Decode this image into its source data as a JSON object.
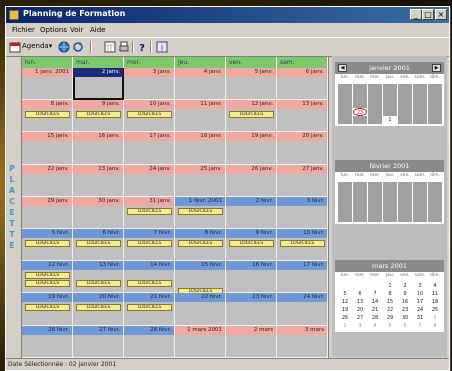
{
  "window": {
    "title": "Planning de Formation"
  },
  "title_buttons": [
    "_",
    "□",
    "×"
  ],
  "menu": [
    "Fichier",
    "Options",
    "Voir",
    "Aide"
  ],
  "toolbar": {
    "agenda_label": "Agenda▾"
  },
  "sidebar_label": [
    "P",
    "L",
    "A",
    "C",
    "E",
    "T",
    "T",
    "E"
  ],
  "week_headers": [
    "lun.",
    "mar.",
    "mer.",
    "jeu.",
    "ven.",
    "sam."
  ],
  "weeks": [
    {
      "color": "red",
      "days": [
        "1 janv. 2001",
        "2 janv.",
        "3 janv.",
        "4 janv.",
        "5 janv.",
        "6 janv."
      ],
      "events": []
    },
    {
      "color": "red",
      "days": [
        "8 janv.",
        "9 janv.",
        "10 janv.",
        "11 janv.",
        "12 janv.",
        "13 janv."
      ],
      "events": [
        [
          0,
          0,
          "LOGICIELS"
        ],
        [
          1,
          0,
          "LOGICIELS"
        ],
        [
          2,
          0,
          "LOGICIELS"
        ],
        [
          4,
          0,
          "LOGICIELS"
        ]
      ]
    },
    {
      "color": "red",
      "days": [
        "15 janv.",
        "16 janv.",
        "17 janv.",
        "18 janv.",
        "19 janv.",
        "20 janv."
      ],
      "events": []
    },
    {
      "color": "red",
      "days": [
        "22 janv.",
        "23 janv.",
        "24 janv.",
        "25 janv.",
        "26 janv.",
        "27 janv."
      ],
      "events": []
    },
    {
      "color": "mix",
      "days": [
        "29 janv.",
        "30 janv.",
        "31 janv.",
        "1 févr. 2001",
        "2 févr.",
        "3 févr."
      ],
      "events": [
        [
          2,
          0,
          "LOGICIELS"
        ],
        [
          3,
          0,
          "LOGICIELS"
        ]
      ]
    },
    {
      "color": "blue",
      "days": [
        "5 févr.",
        "6 févr.",
        "7 févr.",
        "8 févr.",
        "9 févr.",
        "10 févr."
      ],
      "events": [
        [
          0,
          0,
          "LOGICIELS"
        ],
        [
          1,
          0,
          "LOGICIELS"
        ],
        [
          2,
          0,
          "LOGICIELS"
        ],
        [
          3,
          0,
          "LOGICIELS"
        ],
        [
          4,
          0,
          "LOGICIELS"
        ],
        [
          5,
          0,
          "LOGICIELS"
        ]
      ]
    },
    {
      "color": "blue",
      "days": [
        "12 févr.",
        "13 févr.",
        "14 févr.",
        "15 févr.",
        "16 févr.",
        "17 févr."
      ],
      "events": [
        [
          0,
          0,
          "LOGICIELS"
        ],
        [
          0,
          1,
          "LOGICIELS"
        ],
        [
          1,
          1,
          "LOGICIELS"
        ],
        [
          2,
          1,
          "LOGICIELS"
        ],
        [
          3,
          2,
          "LOGICIELS"
        ]
      ]
    },
    {
      "color": "blue",
      "days": [
        "19 févr.",
        "20 févr.",
        "21 févr.",
        "22 févr.",
        "23 févr.",
        "24 févr."
      ],
      "events": [
        [
          0,
          0,
          "LOGICIELS"
        ],
        [
          1,
          0,
          "LOGICIELS"
        ],
        [
          2,
          0,
          "LOGICIELS"
        ]
      ]
    },
    {
      "color": "mix2",
      "days": [
        "26 févr.",
        "27 févr.",
        "28 févr.",
        "1 mars 2001",
        "2 mars",
        "3 mars"
      ],
      "events": []
    }
  ],
  "calendars": [
    {
      "title": "janvier 2001",
      "dows": [
        "lun.",
        "mar.",
        "mer.",
        "jeu.",
        "ven.",
        "sam.",
        "dim."
      ],
      "rows": [
        [
          "1",
          "2",
          "3",
          "4",
          "5",
          "6",
          "7"
        ],
        [
          "8",
          "9",
          "10",
          "11",
          "12",
          "13",
          "14"
        ],
        [
          "15",
          "16",
          "17",
          "18",
          "19",
          "20",
          "21"
        ],
        [
          "22",
          "23",
          "24",
          "25",
          "26",
          "27",
          "28"
        ],
        [
          "29",
          "30",
          "31",
          "1",
          "2",
          "3",
          "4"
        ]
      ]
    },
    {
      "title": "février 2001",
      "dows": [
        "lun.",
        "mar.",
        "mer.",
        "jeu.",
        "ven.",
        "sam.",
        "dim."
      ],
      "rows": [
        [
          "29",
          "30",
          "31",
          "1",
          "2",
          "3",
          "4"
        ],
        [
          "5",
          "6",
          "7",
          "8",
          "9",
          "10",
          "11"
        ],
        [
          "12",
          "13",
          "14",
          "15",
          "16",
          "17",
          "18"
        ],
        [
          "19",
          "20",
          "21",
          "22",
          "23",
          "24",
          "25"
        ],
        [
          "26",
          "27",
          "28",
          "1",
          "2",
          "3",
          "4"
        ]
      ]
    },
    {
      "title": "mars 2001",
      "dows": [
        "lun.",
        "mar.",
        "mer.",
        "jeu.",
        "ven.",
        "sam.",
        "dim."
      ],
      "rows": [
        [
          "",
          "",
          "",
          "1",
          "2",
          "3",
          "4"
        ],
        [
          "5",
          "6",
          "7",
          "8",
          "9",
          "10",
          "11"
        ],
        [
          "12",
          "13",
          "14",
          "15",
          "16",
          "17",
          "18"
        ],
        [
          "19",
          "20",
          "21",
          "22",
          "23",
          "24",
          "25"
        ],
        [
          "26",
          "27",
          "28",
          "29",
          "30",
          "31",
          "1"
        ],
        [
          "2",
          "3",
          "4",
          "5",
          "6",
          "7",
          "8"
        ]
      ]
    }
  ],
  "status": {
    "text": "Date Sélectionnée : 02 janvier 2001"
  },
  "colors": {
    "red": "#f0a8a0",
    "blue": "#6f98d8",
    "header_green": "#7cc86a",
    "event_yellow": "#f4ec8e"
  }
}
